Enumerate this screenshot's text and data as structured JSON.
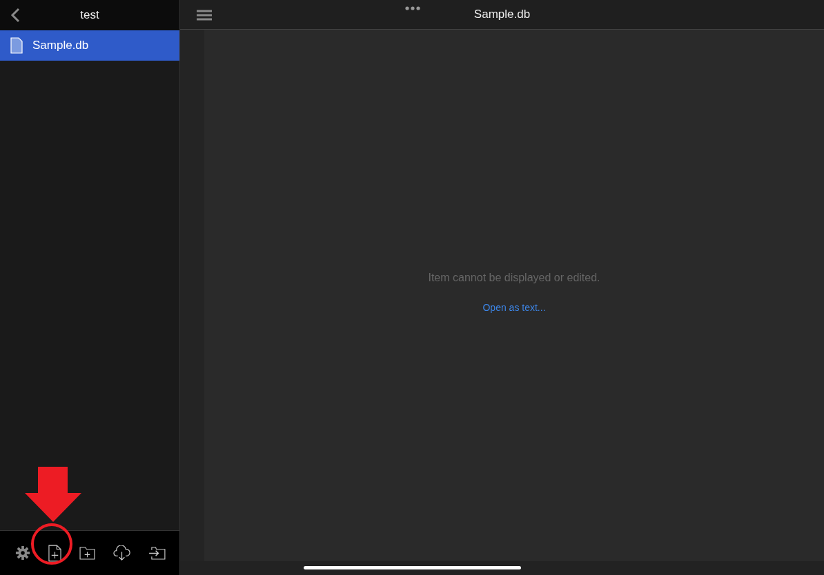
{
  "sidebar": {
    "title": "test",
    "files": [
      {
        "name": "Sample.db",
        "selected": true
      }
    ]
  },
  "main": {
    "title": "Sample.db",
    "message": "Item cannot be displayed or edited.",
    "link": "Open as text..."
  }
}
